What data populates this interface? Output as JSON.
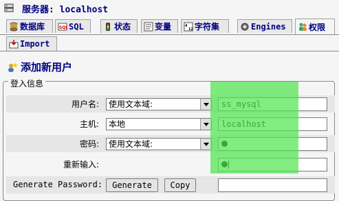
{
  "server": {
    "label": "服务器:",
    "value": "localhost"
  },
  "tabs": [
    {
      "label": "数据库",
      "icon": "database-icon"
    },
    {
      "label": "SQL",
      "icon": "sql-icon"
    },
    {
      "label": "状态",
      "icon": "status-icon"
    },
    {
      "label": "变量",
      "icon": "variables-icon"
    },
    {
      "label": "字符集",
      "icon": "charset-icon"
    },
    {
      "label": "Engines",
      "icon": "engines-icon"
    },
    {
      "label": "权限",
      "icon": "privileges-icon",
      "active": true
    }
  ],
  "tabs_row2": [
    {
      "label": "Import",
      "icon": "import-icon"
    }
  ],
  "section": {
    "title": "添加新用户",
    "icon": "add-user-icon"
  },
  "login_info": {
    "legend": "登入信息",
    "fields": [
      {
        "label": "用户名:",
        "select": "使用文本域:",
        "value": "ss_mysql"
      },
      {
        "label": "主机:",
        "select": "本地",
        "value": "localhost"
      },
      {
        "label": "密码:",
        "select": "使用文本域:",
        "value": "•"
      },
      {
        "label": "重新输入:",
        "value": "•"
      }
    ],
    "generate": {
      "label": "Generate Password:",
      "generate_btn": "Generate",
      "copy_btn": "Copy",
      "value": ""
    }
  },
  "colors": {
    "link": "#000080",
    "highlight": "#50e650",
    "row_bg": "#e6e6e6"
  }
}
